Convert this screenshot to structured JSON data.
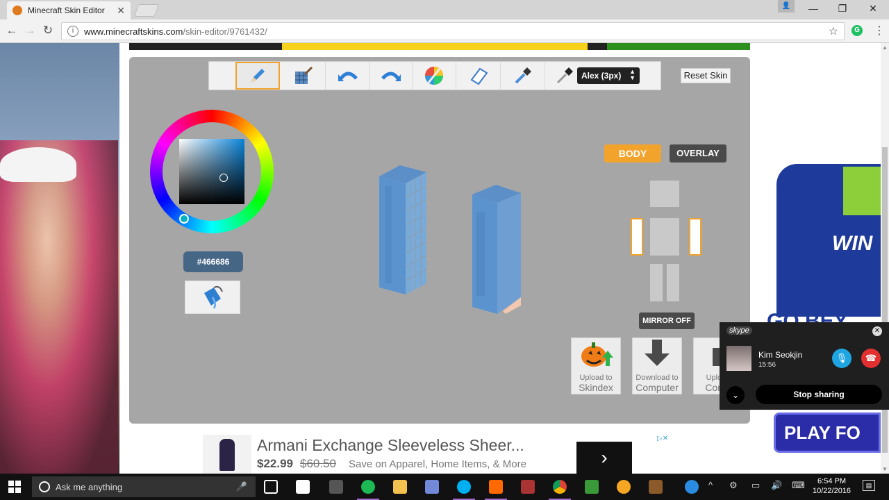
{
  "browser": {
    "tab_title": "Minecraft Skin Editor",
    "tab_close": "✕",
    "url_host": "www.minecraftskins.com",
    "url_path": "/skin-editor/9761432/",
    "info_glyph": "i",
    "star_glyph": "☆",
    "menu_glyph": "⋮",
    "ext_label": "G",
    "window_controls": {
      "minimize": "—",
      "restore": "❐",
      "close": "✕"
    }
  },
  "editor": {
    "tools": [
      {
        "name": "pencil",
        "icon": "pencil-icon",
        "active": true
      },
      {
        "name": "noise-brush",
        "icon": "noise-brush-icon",
        "active": false
      },
      {
        "name": "undo",
        "icon": "undo-icon",
        "active": false
      },
      {
        "name": "redo",
        "icon": "redo-icon",
        "active": false
      },
      {
        "name": "color-picker",
        "icon": "color-palette-icon",
        "active": false
      },
      {
        "name": "eraser",
        "icon": "eraser-icon",
        "active": false
      },
      {
        "name": "dropper",
        "icon": "dropper-icon",
        "active": false
      },
      {
        "name": "pen",
        "icon": "pen-icon",
        "active": false
      }
    ],
    "model_select": "Alex (3px)",
    "reset_label": "Reset Skin",
    "color_hex": "#466686",
    "body_label": "BODY",
    "overlay_label": "OVERLAY",
    "mirror_label": "MIRROR OFF",
    "actions": [
      {
        "small": "Upload to",
        "big": "Skindex"
      },
      {
        "small": "Download to",
        "big": "Computer"
      },
      {
        "small": "Upload",
        "big": "Comp"
      }
    ],
    "colors": {
      "accent": "#f2a32b",
      "panel": "#a6a6a6",
      "selected_color": "#466686"
    }
  },
  "ads": {
    "bottom_title": "Armani Exchange Sleeveless Sheer...",
    "bottom_price": "$22.99",
    "bottom_old_price": "$60.50",
    "bottom_desc": "Save on Apparel, Home Items, & More",
    "next_glyph": "›",
    "adchoices": "▷✕",
    "right_text1": "WIN",
    "right_text2": "GO BEY",
    "right_play": "PLAY FO"
  },
  "skype": {
    "brand": "skype",
    "caller": "Kim Seokjin",
    "duration": "15:56",
    "stop_label": "Stop sharing"
  },
  "taskbar": {
    "search_placeholder": "Ask me anything",
    "time": "6:54 PM",
    "date": "10/22/2016"
  }
}
